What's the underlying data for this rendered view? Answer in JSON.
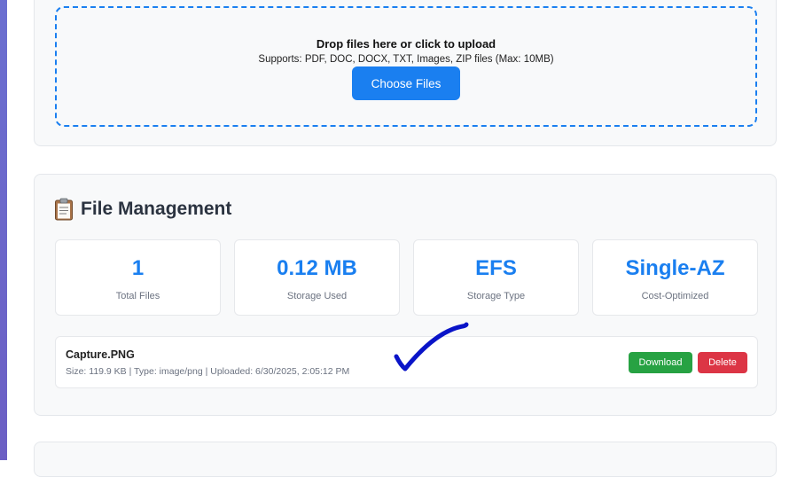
{
  "upload": {
    "title": "Drop files here or click to upload",
    "supports": "Supports: PDF, DOC, DOCX, TXT, Images, ZIP files (Max: 10MB)",
    "button_label": "Choose Files"
  },
  "file_management": {
    "title": "File Management",
    "icon": "clipboard-icon",
    "stats": [
      {
        "value": "1",
        "label": "Total Files"
      },
      {
        "value": "0.12 MB",
        "label": "Storage Used"
      },
      {
        "value": "EFS",
        "label": "Storage Type"
      },
      {
        "value": "Single-AZ",
        "label": "Cost-Optimized"
      }
    ],
    "files": [
      {
        "name": "Capture.PNG",
        "meta": "Size: 119.9 KB | Type: image/png | Uploaded: 6/30/2025, 2:05:12 PM",
        "download_label": "Download",
        "delete_label": "Delete"
      }
    ]
  },
  "colors": {
    "accent": "#1a7ff0",
    "download": "#27a243",
    "delete": "#dc3545",
    "annotation": "#0a14c8"
  }
}
